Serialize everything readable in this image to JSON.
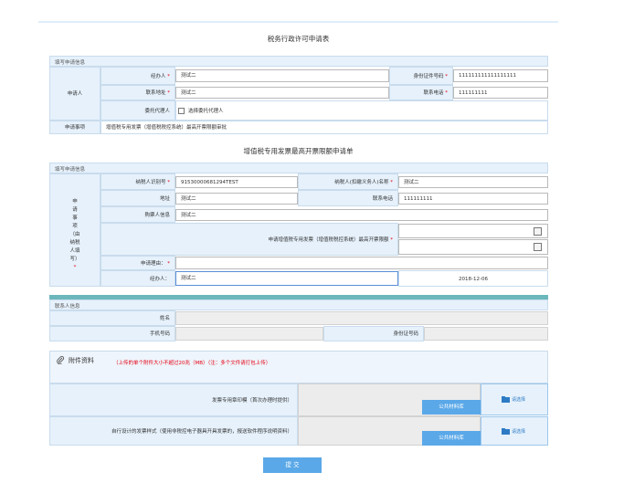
{
  "form_title": "税务行政许可申请表",
  "applicant_section": {
    "header": "填写申请信息",
    "applicant_label": "申请人",
    "handler_label": "经办人",
    "handler_value": "测试二",
    "id_label": "身份证件号码",
    "id_value": "111111111111111111",
    "address_label": "联系地址",
    "address_value": "测试二",
    "phone_label": "联系电话",
    "phone_value": "111111111",
    "agent_label": "委托代理人",
    "agent_checkbox_label": "选择委托代理人",
    "matter_label": "申请事项",
    "matter_value": "增值税专用发票（增值税税控系统）最高开票限额审批"
  },
  "invoice_title": "增值税专用发票最高开票限额申请单",
  "invoice_section": {
    "header": "填写申请信息",
    "side_label_lines": [
      "申",
      "请",
      "事",
      "项",
      "（由",
      "纳税",
      "人填",
      "写）"
    ],
    "side_required": "*",
    "taxpayer_id_label": "纳税人识别号",
    "taxpayer_id_value": "91530000681294TEST",
    "taxpayer_name_label": "纳税人(扣缴义务人)名称",
    "taxpayer_name_value": "测试二",
    "address_label": "地址",
    "address_value": "测试二",
    "phone_label": "联系电话",
    "phone_value": "111111111",
    "buyer_label": "购票人信息",
    "buyer_value": "测试二",
    "limit_label": "申请增值税专用发票（增值税税控系统）最高开票限额",
    "reason_label": "申请理由：",
    "handler_label": "经办人：",
    "handler_value": "测试二",
    "date_value": "2018-12-06"
  },
  "contact_section": {
    "header": "联系人信息",
    "name_label": "姓名",
    "mobile_label": "手机号码",
    "id_label": "身份证号码"
  },
  "attachments": {
    "title": "附件资料",
    "note": "（上传的单个附件大小不超过20兆（MB）（注：多个文件请打包上传）",
    "items": [
      {
        "label": "发票专用章印模（首次办理时提供）",
        "public_button": "公共材料库",
        "upload_button": "请选择"
      },
      {
        "label": "自行设计的发票样式（使用非税控电子器具开具发票的，报送软件程序说明资料）",
        "public_button": "公共材料库",
        "upload_button": "请选择"
      }
    ]
  },
  "submit_label": "提 交"
}
